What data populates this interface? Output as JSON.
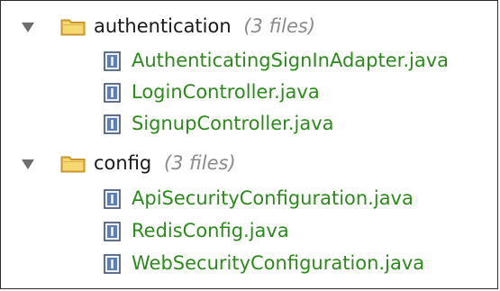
{
  "tree": {
    "folders": [
      {
        "name": "authentication",
        "count": "(3 files)",
        "files": [
          "AuthenticatingSignInAdapter.java",
          "LoginController.java",
          "SignupController.java"
        ]
      },
      {
        "name": "config",
        "count": "(3 files)",
        "files": [
          "ApiSecurityConfiguration.java",
          "RedisConfig.java",
          "WebSecurityConfiguration.java"
        ]
      }
    ]
  },
  "icons": {
    "expand": "caret-down-icon",
    "folder": "folder-icon",
    "file": "java-file-icon"
  },
  "colors": {
    "file_text": "#2c8a1c",
    "folder_text": "#1a1a1a",
    "count_text": "#8a8a8a",
    "folder_fill": "#f6d873",
    "folder_stroke": "#c8962a"
  }
}
